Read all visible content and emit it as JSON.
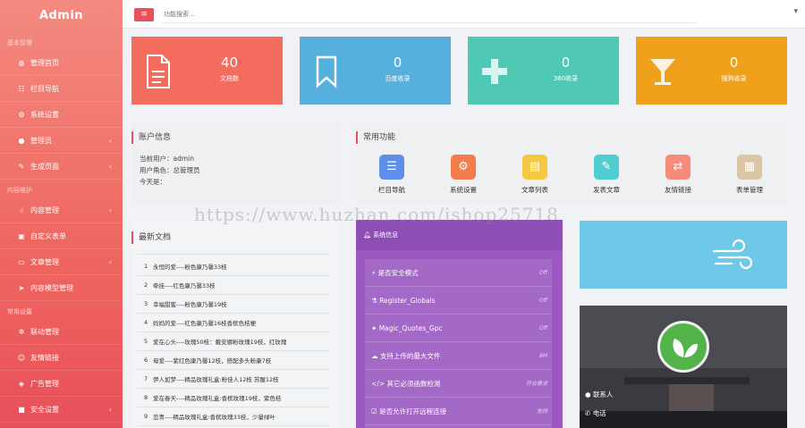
{
  "sidebar": {
    "brand": "Admin",
    "groups": [
      {
        "title": "基本管理",
        "items": [
          {
            "label": "管理首页",
            "icon": "dashboard-icon",
            "glyph": "◍",
            "arrow": false
          },
          {
            "label": "栏目导航",
            "icon": "list-icon",
            "glyph": "☷",
            "arrow": false
          },
          {
            "label": "系统设置",
            "icon": "gear-icon",
            "glyph": "⚙",
            "arrow": false
          },
          {
            "label": "管理员",
            "icon": "user-icon",
            "glyph": "●",
            "arrow": true
          },
          {
            "label": "生成页面",
            "icon": "pencil-icon",
            "glyph": "✎",
            "arrow": true
          }
        ]
      },
      {
        "title": "内容维护",
        "items": [
          {
            "label": "内容管理",
            "icon": "hand-icon",
            "glyph": "☝",
            "arrow": true
          },
          {
            "label": "自定义表单",
            "icon": "form-icon",
            "glyph": "▣",
            "arrow": false
          },
          {
            "label": "文章管理",
            "icon": "folder-icon",
            "glyph": "▭",
            "arrow": true
          },
          {
            "label": "内容模型管理",
            "icon": "send-icon",
            "glyph": "➤",
            "arrow": false
          }
        ]
      },
      {
        "title": "常用设置",
        "items": [
          {
            "label": "联动管理",
            "icon": "cog-icon",
            "glyph": "✲",
            "arrow": false
          },
          {
            "label": "友情链接",
            "icon": "users-icon",
            "glyph": "☺",
            "arrow": false
          },
          {
            "label": "广告管理",
            "icon": "cube-icon",
            "glyph": "◈",
            "arrow": false
          },
          {
            "label": "安全设置",
            "icon": "lock-icon",
            "glyph": "■",
            "arrow": true
          }
        ]
      }
    ]
  },
  "topbar": {
    "search_placeholder": "功能搜索...",
    "menu_glyph": "≡"
  },
  "stats": [
    {
      "value": "40",
      "label": "文档数",
      "color": "#f36c5e",
      "icon": "document-icon"
    },
    {
      "value": "0",
      "label": "百度收录",
      "color": "#56b0de",
      "icon": "bookmark-icon"
    },
    {
      "value": "0",
      "label": "360收录",
      "color": "#4fc8b6",
      "icon": "plus-icon"
    },
    {
      "value": "0",
      "label": "搜狗收录",
      "color": "#f0a11b",
      "icon": "cocktail-icon"
    }
  ],
  "account": {
    "title": "账户信息",
    "lines": [
      "当前用户：admin",
      "用户角色：总管理员",
      "今天是："
    ]
  },
  "quick": {
    "title": "常用功能",
    "items": [
      {
        "label": "栏目导航",
        "color": "#5d8fe8",
        "icon": "list-icon",
        "glyph": "☰"
      },
      {
        "label": "系统设置",
        "color": "#f47c4a",
        "icon": "gear-icon",
        "glyph": "⚙"
      },
      {
        "label": "文章列表",
        "color": "#f5c842",
        "icon": "file-icon",
        "glyph": "▤"
      },
      {
        "label": "发表文章",
        "color": "#4fcdd0",
        "icon": "brush-icon",
        "glyph": "✎"
      },
      {
        "label": "友情链接",
        "color": "#f58b78",
        "icon": "exchange-icon",
        "glyph": "⇄"
      },
      {
        "label": "表单管理",
        "color": "#dac6a4",
        "icon": "form-icon",
        "glyph": "▦"
      }
    ]
  },
  "news": {
    "title": "最新文档",
    "items": [
      {
        "idx": "1",
        "text": "永恒的爱----粉色康乃馨33枝"
      },
      {
        "idx": "2",
        "text": "牵挂----红色康乃馨33枝"
      },
      {
        "idx": "3",
        "text": "幸福甜蜜----粉色康乃馨19枝"
      },
      {
        "idx": "4",
        "text": "妈妈的爱----红色康乃馨16枝香槟色桔梗"
      },
      {
        "idx": "5",
        "text": "爱在心头----玫瑰50枝：戴安娜粉玫瑰19枝，红玫瑰"
      },
      {
        "idx": "6",
        "text": "母爱----紫红色康乃馨12枝，搭配多头粉康7枝"
      },
      {
        "idx": "7",
        "text": "伊人如梦----精品玫瑰礼盒:粉佳人12枝 苏醒12枝"
      },
      {
        "idx": "8",
        "text": "爱在春天----精品玫瑰礼盒:香槟玫瑰19枝，紫色桔"
      },
      {
        "idx": "9",
        "text": "恋青----精品玫瑰礼盒:香槟玫瑰33枝，少量绿叶"
      }
    ]
  },
  "system": {
    "title": "系统信息",
    "rows": [
      {
        "label": "是否安全模式",
        "value": "Off",
        "icon": "bolt-icon",
        "glyph": "⚡"
      },
      {
        "label": "Register_Globals",
        "value": "Off",
        "icon": "flask-icon",
        "glyph": "⚗"
      },
      {
        "label": "Magic_Quotes_Gpc",
        "value": "Off",
        "icon": "magic-icon",
        "glyph": "✦"
      },
      {
        "label": "支持上传的最大文件",
        "value": "8M",
        "icon": "cloud-icon",
        "glyph": "☁"
      },
      {
        "label": "其它必须函数检测",
        "value": "符合要求",
        "icon": "code-icon",
        "glyph": "</>"
      },
      {
        "label": "是否允许打开远程连接",
        "value": "支持",
        "icon": "check-icon",
        "glyph": "☑"
      }
    ]
  },
  "contact": {
    "items": [
      {
        "label": "联系人",
        "icon": "user-icon",
        "glyph": "●"
      },
      {
        "label": "电话",
        "icon": "phone-icon",
        "glyph": "✆"
      }
    ]
  },
  "watermark": "https://www.huzhan.com/ishop25718"
}
